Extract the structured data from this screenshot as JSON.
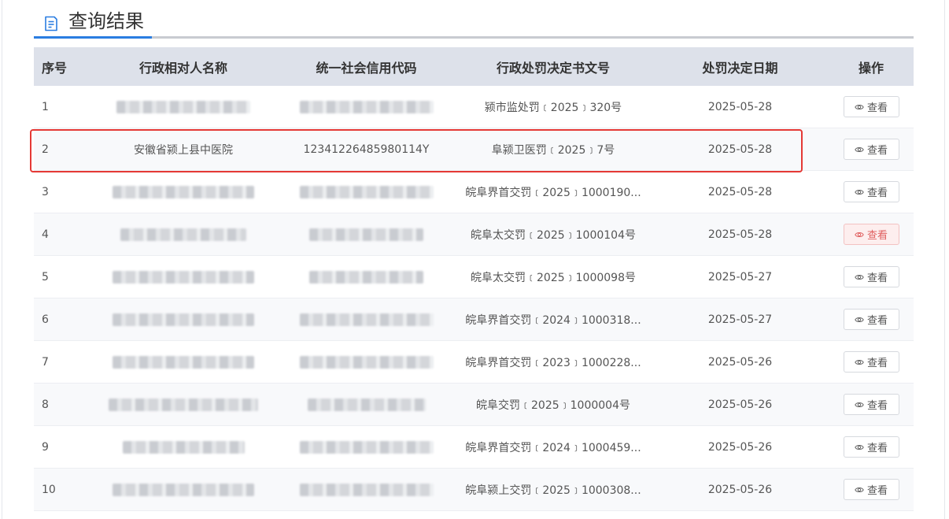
{
  "section": {
    "title": "查询结果",
    "icon": "document-list-icon"
  },
  "table": {
    "headers": {
      "no": "序号",
      "name": "行政相对人名称",
      "credit_code": "统一社会信用代码",
      "doc_no": "行政处罚决定书文号",
      "date": "处罚决定日期",
      "action": "操作"
    },
    "rows": [
      {
        "no": "1",
        "name": "",
        "credit_code": "",
        "doc_no": "颍市监处罚﹝2025﹞320号",
        "date": "2025-05-28",
        "action": "查看"
      },
      {
        "no": "2",
        "name": "安徽省颍上县中医院",
        "credit_code": "12341226485980114Y",
        "doc_no": "阜颍卫医罚﹝2025﹞7号",
        "date": "2025-05-28",
        "action": "查看"
      },
      {
        "no": "3",
        "name": "",
        "credit_code": "",
        "doc_no": "皖阜界首交罚﹝2025﹞1000190...",
        "date": "2025-05-28",
        "action": "查看"
      },
      {
        "no": "4",
        "name": "",
        "credit_code": "",
        "doc_no": "皖阜太交罚﹝2025﹞1000104号",
        "date": "2025-05-28",
        "action": "查看"
      },
      {
        "no": "5",
        "name": "",
        "credit_code": "",
        "doc_no": "皖阜太交罚﹝2025﹞1000098号",
        "date": "2025-05-27",
        "action": "查看"
      },
      {
        "no": "6",
        "name": "",
        "credit_code": "",
        "doc_no": "皖阜界首交罚﹝2024﹞1000318...",
        "date": "2025-05-27",
        "action": "查看"
      },
      {
        "no": "7",
        "name": "",
        "credit_code": "",
        "doc_no": "皖阜界首交罚﹝2023﹞1000228...",
        "date": "2025-05-26",
        "action": "查看"
      },
      {
        "no": "8",
        "name": "",
        "credit_code": "",
        "doc_no": "皖阜交罚﹝2025﹞1000004号",
        "date": "2025-05-26",
        "action": "查看"
      },
      {
        "no": "9",
        "name": "",
        "credit_code": "",
        "doc_no": "皖阜界首交罚﹝2024﹞1000459...",
        "date": "2025-05-26",
        "action": "查看"
      },
      {
        "no": "10",
        "name": "",
        "credit_code": "",
        "doc_no": "皖阜颍上交罚﹝2025﹞1000308...",
        "date": "2025-05-26",
        "action": "查看"
      }
    ]
  },
  "colors": {
    "accent": "#2a7de1",
    "header_bg": "#dde1ea",
    "highlight": "#e53935",
    "hover_button_bg": "#fdeeee"
  }
}
